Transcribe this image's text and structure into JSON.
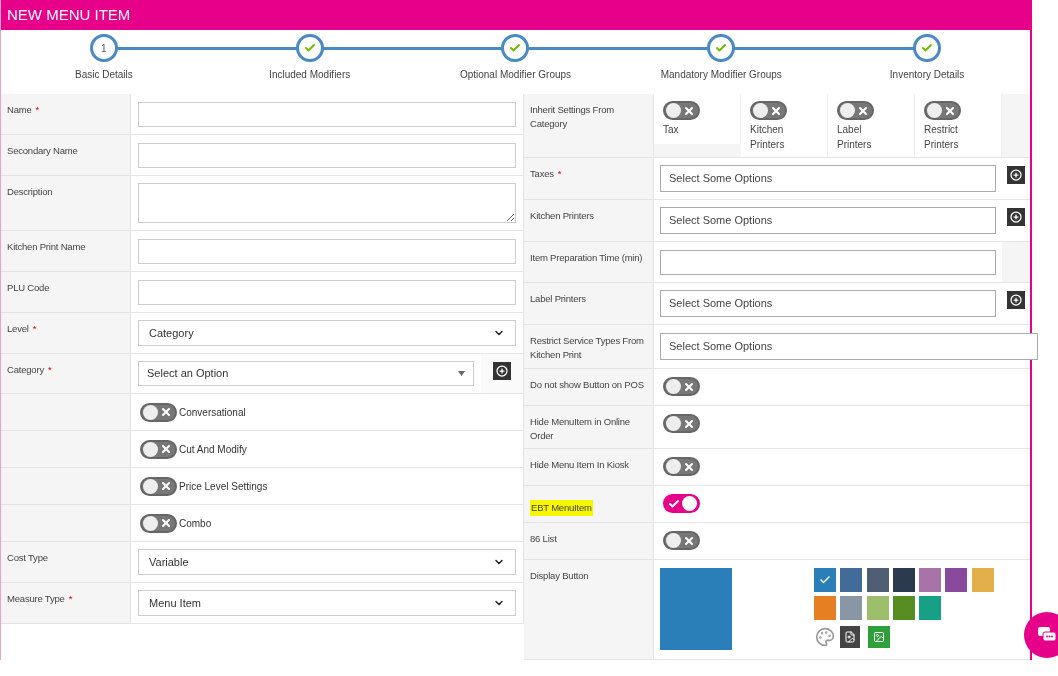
{
  "header": {
    "title": "NEW MENU ITEM"
  },
  "steps": [
    {
      "label": "Basic Details",
      "marker": "1",
      "completed": false
    },
    {
      "label": "Included Modifiers",
      "completed": true
    },
    {
      "label": "Optional Modifier Groups",
      "completed": true
    },
    {
      "label": "Mandatory Modifier Groups",
      "completed": true
    },
    {
      "label": "Inventory Details",
      "completed": true
    }
  ],
  "left_rows": [
    {
      "kind": "input",
      "label": "Name",
      "required_mark": "*"
    },
    {
      "kind": "input",
      "label": "Secondary Name"
    },
    {
      "kind": "textarea",
      "label": "Description"
    },
    {
      "kind": "input",
      "label": "Kitchen Print Name"
    },
    {
      "kind": "input",
      "label": "PLU Code"
    },
    {
      "kind": "select",
      "label": "Level",
      "required_mark": "*",
      "value": "Category"
    },
    {
      "kind": "combo",
      "label": "Category",
      "required_mark": "*",
      "placeholder": "Select an Option"
    },
    {
      "kind": "toggle",
      "option": "Conversational",
      "on": false
    },
    {
      "kind": "toggle",
      "option": "Cut And Modify",
      "on": false
    },
    {
      "kind": "toggle",
      "option": "Price Level Settings",
      "on": false
    },
    {
      "kind": "toggle",
      "option": "Combo",
      "on": false
    },
    {
      "kind": "select",
      "label": "Cost Type",
      "value": "Variable"
    },
    {
      "kind": "select",
      "label": "Measure Type",
      "required_mark": "*",
      "value": "Menu Item"
    }
  ],
  "right_rows": [
    {
      "kind": "inherit",
      "label": "Inherit Settings From Category",
      "toggles": [
        {
          "label": "Tax",
          "on": false
        },
        {
          "label": "Kitchen Printers",
          "on": false
        },
        {
          "label": "Label Printers",
          "on": false
        },
        {
          "label": "Restrict Printers",
          "on": false
        }
      ]
    },
    {
      "kind": "multiselect",
      "label": "Taxes",
      "required_mark": "*",
      "placeholder": "Select Some Options",
      "add_button": true
    },
    {
      "kind": "multiselect",
      "label": "Kitchen Printers",
      "placeholder": "Select Some Options",
      "add_button": true
    },
    {
      "kind": "input",
      "label": "Item Preparation Time (min)"
    },
    {
      "kind": "multiselect",
      "label": "Label Printers",
      "placeholder": "Select Some Options",
      "add_button": true
    },
    {
      "kind": "multiselect",
      "label": "Restrict Service Types From Kitchen Print",
      "placeholder": "Select Some Options",
      "add_button": false
    },
    {
      "kind": "toggle",
      "label": "Do not show Button on POS",
      "on": false
    },
    {
      "kind": "toggle",
      "label": "Hide MenuItem in Online Order",
      "on": false
    },
    {
      "kind": "toggle",
      "label": "Hide Menu Item In Kiosk",
      "on": false
    },
    {
      "kind": "toggle",
      "label": "EBT MenuItem",
      "on": true,
      "highlighted": true
    },
    {
      "kind": "toggle",
      "label": "86 List",
      "on": false
    },
    {
      "kind": "display",
      "label": "Display Button",
      "swatches": [
        {
          "color": "#2a7fb8",
          "selected": true
        },
        {
          "color": "#436b98",
          "selected": false
        },
        {
          "color": "#4f5e73",
          "selected": false
        },
        {
          "color": "#2b3a4e",
          "selected": false
        },
        {
          "color": "#a873a8",
          "selected": false
        },
        {
          "color": "#8a4a9c",
          "selected": false
        },
        {
          "color": "#e2af4b",
          "selected": false
        },
        {
          "color": "#e67f22",
          "selected": false
        },
        {
          "color": "#8896a6",
          "selected": false
        },
        {
          "color": "#9bbf6b",
          "selected": false
        },
        {
          "color": "#568e24",
          "selected": false
        },
        {
          "color": "#16a085",
          "selected": false
        }
      ]
    }
  ]
}
